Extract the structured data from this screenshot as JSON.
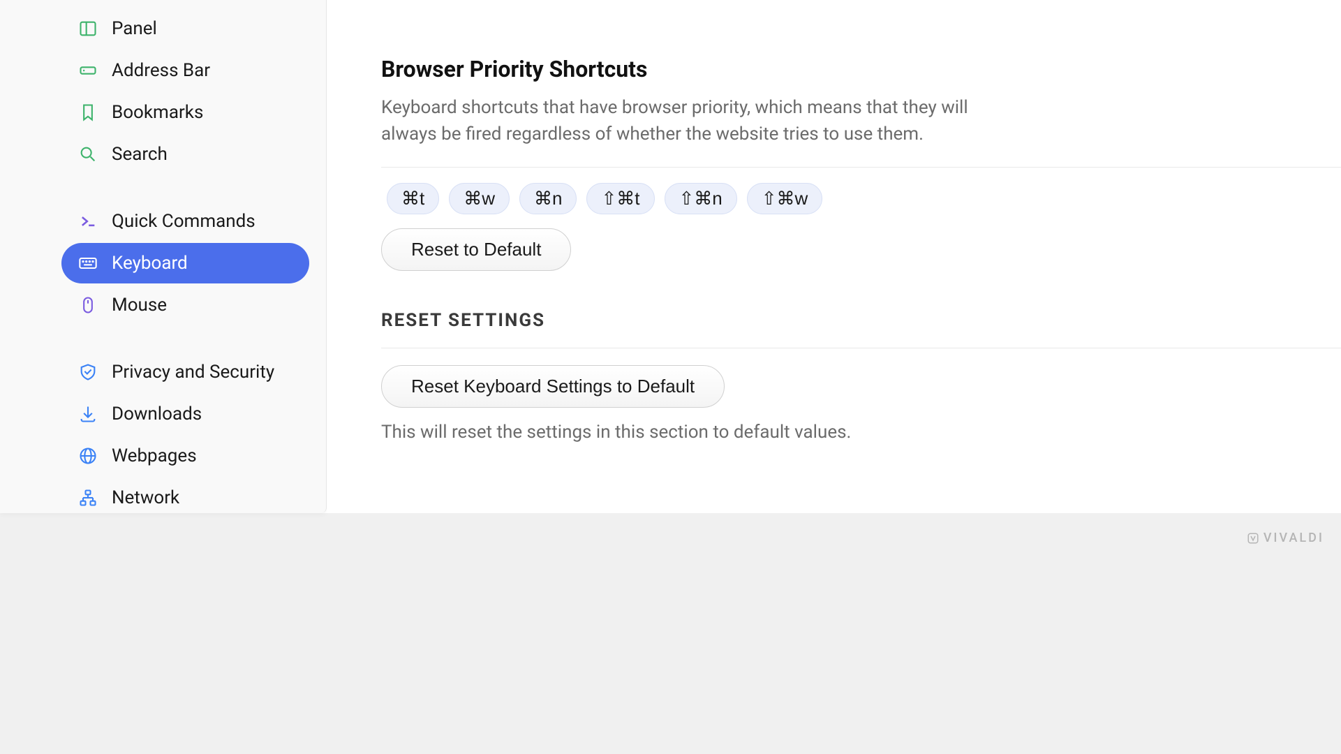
{
  "sidebar": {
    "items": [
      {
        "label": "Panel",
        "icon": "panel"
      },
      {
        "label": "Address Bar",
        "icon": "addressbar"
      },
      {
        "label": "Bookmarks",
        "icon": "bookmark"
      },
      {
        "label": "Search",
        "icon": "search"
      },
      {
        "label": "Quick Commands",
        "icon": "quickcmd"
      },
      {
        "label": "Keyboard",
        "icon": "keyboard"
      },
      {
        "label": "Mouse",
        "icon": "mouse"
      },
      {
        "label": "Privacy and Security",
        "icon": "shield"
      },
      {
        "label": "Downloads",
        "icon": "download"
      },
      {
        "label": "Webpages",
        "icon": "globe"
      },
      {
        "label": "Network",
        "icon": "network"
      }
    ]
  },
  "main": {
    "priority": {
      "title": "Browser Priority Shortcuts",
      "desc": "Keyboard shortcuts that have browser priority, which means that they will always be fired regardless of whether the website tries to use them.",
      "shortcuts": [
        "⌘t",
        "⌘w",
        "⌘n",
        "⇧⌘t",
        "⇧⌘n",
        "⇧⌘w"
      ],
      "reset_btn": "Reset to Default"
    },
    "reset": {
      "heading": "RESET SETTINGS",
      "button": "Reset Keyboard Settings to Default",
      "desc": "This will reset the settings in this section to default values."
    }
  },
  "brand": "VIVALDI"
}
